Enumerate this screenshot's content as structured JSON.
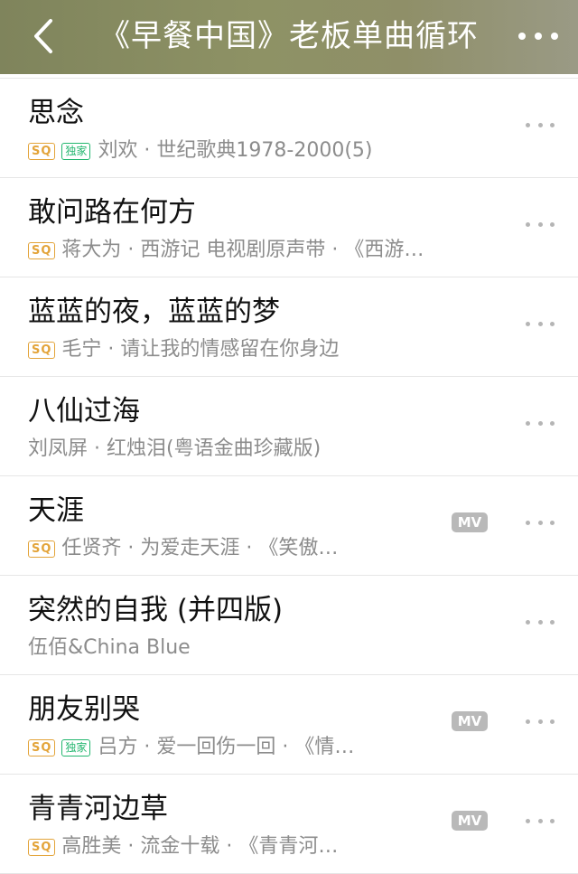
{
  "header": {
    "title": "《早餐中国》老板单曲循环",
    "back_icon": "chevron-left-icon",
    "more_icon": "more-horizontal-icon"
  },
  "songs": [
    {
      "title": "思念",
      "sq": "SQ",
      "exclusive": "独家",
      "meta": "刘欢 · 世纪歌典1978-2000(5)",
      "mv": ""
    },
    {
      "title": "敢问路在何方",
      "sq": "SQ",
      "exclusive": "",
      "meta": "蒋大为 · 西游记 电视剧原声带 · 《西游…",
      "mv": ""
    },
    {
      "title": "蓝蓝的夜，蓝蓝的梦",
      "sq": "SQ",
      "exclusive": "",
      "meta": "毛宁 · 请让我的情感留在你身边",
      "mv": ""
    },
    {
      "title": "八仙过海",
      "sq": "",
      "exclusive": "",
      "meta": "刘凤屏 · 红烛泪(粤语金曲珍藏版)",
      "mv": ""
    },
    {
      "title": "天涯",
      "sq": "SQ",
      "exclusive": "",
      "meta": "任贤齐 · 为爱走天涯 · 《笑傲…",
      "mv": "MV"
    },
    {
      "title": "突然的自我 (并四版)",
      "sq": "",
      "exclusive": "",
      "meta": "伍佰&China Blue",
      "mv": ""
    },
    {
      "title": "朋友别哭",
      "sq": "SQ",
      "exclusive": "独家",
      "meta": "吕方 · 爱一回伤一回 · 《情…",
      "mv": "MV"
    },
    {
      "title": "青青河边草",
      "sq": "SQ",
      "exclusive": "",
      "meta": "高胜美 · 流金十载 · 《青青河…",
      "mv": "MV"
    }
  ],
  "colors": {
    "header_bg": "#8e9265",
    "sq_badge": "#e3a43a",
    "exclusive_badge": "#22b66e",
    "mv_badge": "#b9b9b9",
    "meta_text": "#8c8c8c"
  }
}
